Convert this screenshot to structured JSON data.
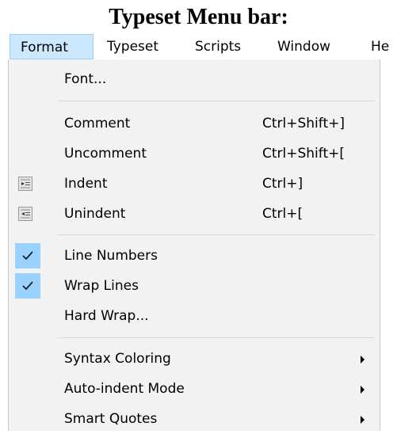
{
  "caption": "Typeset Menu bar:",
  "menubar": {
    "items": [
      "Format",
      "Typeset",
      "Scripts",
      "Window",
      "He"
    ],
    "active": "Format"
  },
  "menu": {
    "font": {
      "label": "Font..."
    },
    "comment": {
      "label": "Comment",
      "shortcut": "Ctrl+Shift+]"
    },
    "uncomment": {
      "label": "Uncomment",
      "shortcut": "Ctrl+Shift+["
    },
    "indent": {
      "label": "Indent",
      "shortcut": "Ctrl+]",
      "icon": "indent-icon"
    },
    "unindent": {
      "label": "Unindent",
      "shortcut": "Ctrl+[",
      "icon": "unindent-icon"
    },
    "line_numbers": {
      "label": "Line Numbers",
      "checked": true
    },
    "wrap_lines": {
      "label": "Wrap Lines",
      "checked": true
    },
    "hard_wrap": {
      "label": "Hard Wrap..."
    },
    "syntax_coloring": {
      "label": "Syntax Coloring",
      "submenu": true
    },
    "auto_indent": {
      "label": "Auto-indent Mode",
      "submenu": true
    },
    "smart_quotes": {
      "label": "Smart Quotes",
      "submenu": true
    }
  },
  "colors": {
    "menu_bg": "#f2f2f2",
    "highlight": "#cce8ff",
    "check_bg": "#99d1ff"
  }
}
